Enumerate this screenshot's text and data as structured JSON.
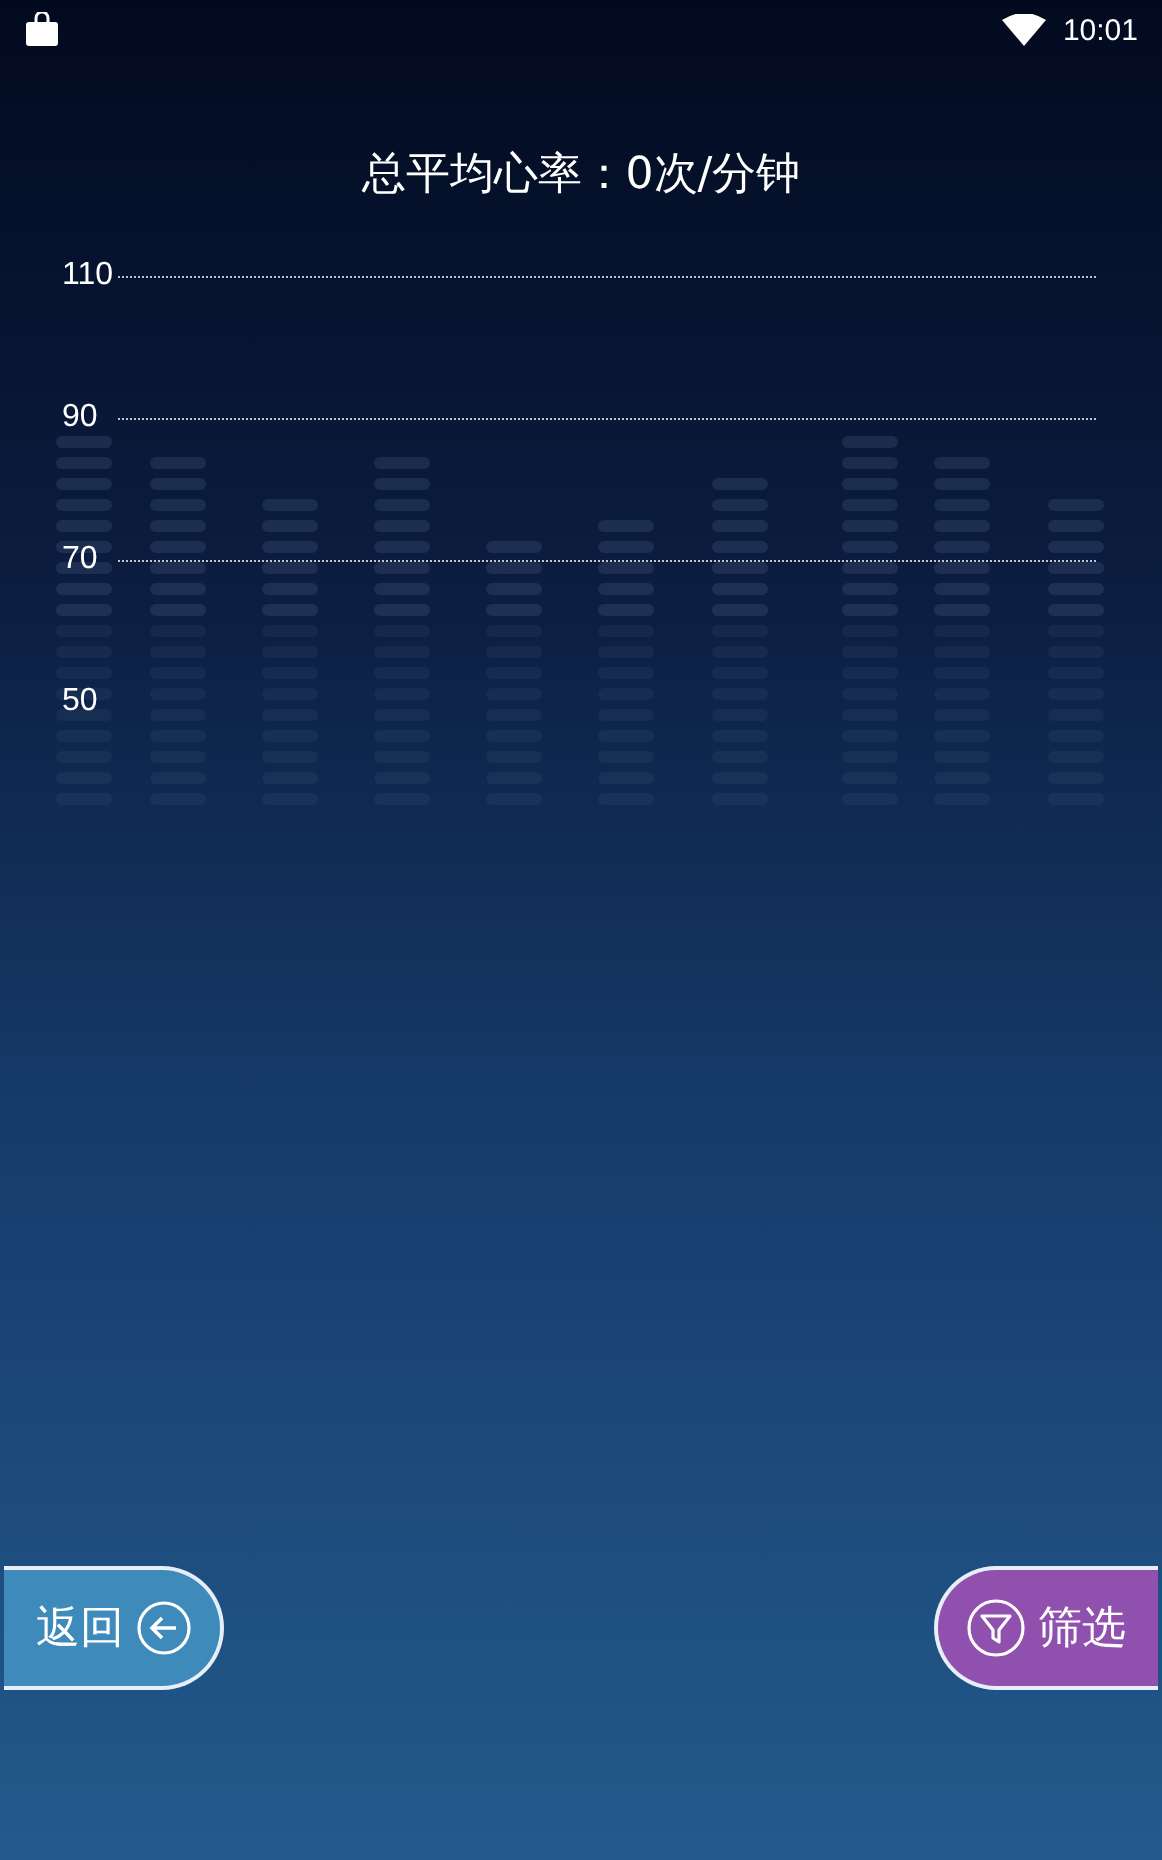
{
  "status_bar": {
    "time": "10:01"
  },
  "title": "总平均心率：0次/分钟",
  "chart_axis": [
    {
      "label": "110",
      "grid": true
    },
    {
      "label": "90",
      "grid": true
    },
    {
      "label": "70",
      "grid": true
    },
    {
      "label": "50",
      "grid": false
    }
  ],
  "buttons": [
    {
      "kind": "back",
      "label": "返回"
    },
    {
      "kind": "filter",
      "label": "筛选"
    }
  ]
}
